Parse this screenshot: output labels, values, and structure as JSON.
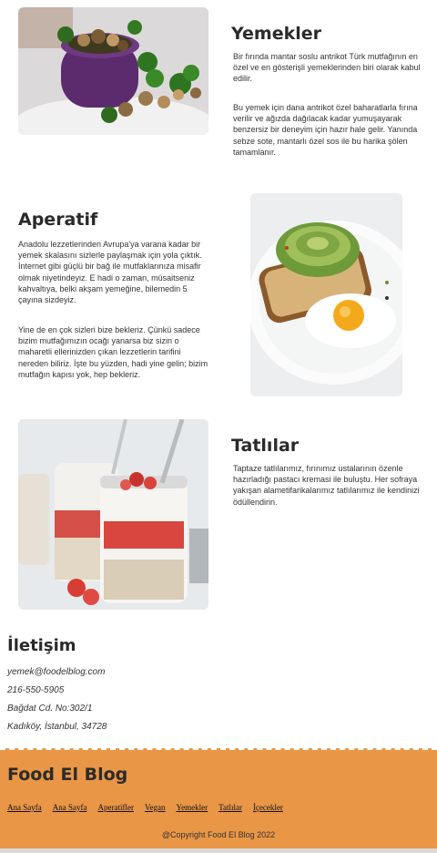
{
  "sections": [
    {
      "title": "Yemekler",
      "paragraphs": [
        "Bir fırında mantar soslu antrikot Türk mutfağının en özel ve en gösterişli yemeklerinden biri olarak kabul edilir.",
        "Bu yemek için dana antrikot özel baharatlarla fırına verilir ve ağızda dağılacak kadar yumuşayarak benzersiz bir deneyim için hazır hale gelir. Yanında sebze sote, mantarlı özel sos ile bu harika şölen tamamlanır."
      ]
    },
    {
      "title": "Aperatif",
      "paragraphs": [
        "Anadolu lezzetlerinden Avrupa'ya varana kadar bir yemek skalasını sizlerle paylaşmak için yola çıktık. İnternet gibi güçlü bir bağ ile mutfaklarınıza misafir olmak niyetindeyiz. E hadi o zaman, müsaitseniz kahvaltıya, belki akşam yemeğine, bilemedin 5 çayına sizdeyiz.",
        "Yine de en çok sizleri bize bekleriz. Çünkü sadece bizim mutfağımızın ocağı yanarsa biz sizin o maharetli ellerinizden çıkan lezzetlerin tarifini nereden biliriz. İşte bu yüzden, hadi yine gelin; bizim mutfağın kapısı yok, hep bekleriz."
      ]
    },
    {
      "title": "Tatlılar",
      "paragraphs": [
        "Taptaze tatlılarımız, fırınımız ustalarının özenle hazırladığı pastacı kremasi ile buluştu. Her sofraya yakışan alametifarikalarımız tatlılarımız ile kendinizi ödüllendirin."
      ]
    }
  ],
  "contact": {
    "title": "İletişim",
    "email": "yemek@foodelblog.com",
    "phone": "216-550-5905",
    "address_line1": "Bağdat Cd. No:302/1",
    "address_line2": "Kadıköy, İstanbul, 34728"
  },
  "footer": {
    "brand": "Food El Blog",
    "nav": [
      "Ana Sayfa",
      "Ana Sayfa",
      "Aperatifler",
      "Vegan",
      "Yemekler",
      "Tatlılar",
      "İçecekler"
    ],
    "copyright": "@Copyright Food El Blog 2022",
    "background_color": "#e99646"
  }
}
